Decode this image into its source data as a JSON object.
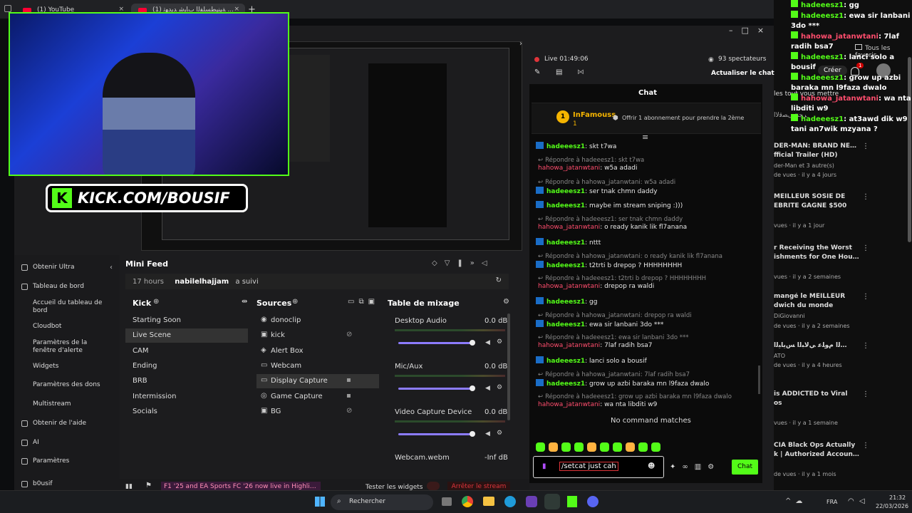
{
  "browser": {
    "tabs": [
      {
        "label": "(1) YouTube"
      },
      {
        "label": "(1) ﺔﻴﻨﻴﻄﺴﻠﻔﻟا بﺎﺒﺷ ﺪﻳﺪﻬﺗ ..."
      }
    ],
    "new_tab": "+"
  },
  "youtube": {
    "favorites_label": "Tous les favoris",
    "create_label": "Créer",
    "notif_count": "1",
    "items": [
      {
        "text": "les tout vous mettre",
        "sub": "ﺮﺠﻨﺗ ﻰﺼﻗﻷا"
      },
      {
        "text": "DER-MAN: BRAND NEW DAY",
        "title2": "fficial Trailer (HD)",
        "channel": "der-Man et 3 autre(s)",
        "meta": "de vues · il y a 4 jours"
      },
      {
        "text": "MEILLEUR SOSIE DE",
        "title2": "ÉBRITÉ GAGNE $500",
        "meta": "vues · il y a 1 jour"
      },
      {
        "text": "r Receiving the Worst",
        "title2": "ishments for One Hour ...",
        "meta": "vues · il y a 2 semaines"
      },
      {
        "text": "mangé le MEILLEUR",
        "title2": "dwich du monde",
        "channel": "DiGiovanni",
        "meta": "de vues · il y a 2 semaines"
      },
      {
        "text": "ﺔﻳﺮﻄﻟا مﻮﻠﻋ ﻲﻟﺎﺒﻟا ﺲﻳﺎﻴﻟا",
        "channel": "ATO",
        "meta": "de vues · il y a 4 heures"
      },
      {
        "text": "is ADDICTED to Viral",
        "title2": "os",
        "meta": "vues · il y a 1 semaine"
      },
      {
        "text": "CIA Black Ops Actually",
        "title2": "k | Authorized Account | ...",
        "meta": "de vues · il y a 1 mois"
      }
    ]
  },
  "overlay_chat": [
    {
      "user": "hadeeesz1",
      "text": "gg"
    },
    {
      "user": "hadeeesz1",
      "text": "ewa sir lanbani 3do ***"
    },
    {
      "user": "hahowa_jatanwtani",
      "text": "7laf radih bsa7"
    },
    {
      "user": "hadeeesz1",
      "text": "lanci solo a bousif"
    },
    {
      "user": "hadeeesz1",
      "text": "grow up azbi baraka mn l9faza dwalo"
    },
    {
      "user": "hahowa_jatanwtani",
      "text": "wa nta libditi w9"
    },
    {
      "user": "hadeeesz1",
      "text": "at3awd dik w9 tani an7wik mzyana ?"
    }
  ],
  "cam_overlay": {
    "url_text": "KICK.COM/BOUSIF"
  },
  "obs": {
    "live_label": "Live 01:49:06",
    "viewers": "93 spectateurs",
    "refresh_chat": "Actualiser le chat",
    "sidebar": [
      {
        "label": "Obtenir Ultra"
      },
      {
        "label": "Tableau de bord"
      },
      {
        "label": "Accueil du tableau de bord"
      },
      {
        "label": "Cloudbot"
      },
      {
        "label": "Paramètres de la fenêtre d'alerte"
      },
      {
        "label": "Widgets"
      },
      {
        "label": "Paramètres des dons"
      },
      {
        "label": "Multistream"
      },
      {
        "label": "Obtenir de l'aide"
      },
      {
        "label": "AI"
      },
      {
        "label": "Paramètres"
      },
      {
        "label": "b0usif"
      }
    ],
    "mini_feed": {
      "title": "Mini Feed",
      "time": "17 hours",
      "user": "nabilelhajjam",
      "action": "a suivi"
    },
    "scenes": {
      "title": "Kick",
      "items": [
        "Starting Soon",
        "Live Scene",
        "CAM",
        "Ending",
        "BRB",
        "Intermission",
        "Socials"
      ],
      "active": "Live Scene"
    },
    "sources": {
      "title": "Sources",
      "items": [
        "donoclip",
        "kick",
        "Alert Box",
        "Webcam",
        "Display Capture",
        "Game Capture",
        "BG"
      ],
      "active": "Display Capture"
    },
    "mixer": {
      "title": "Table de mixage",
      "channels": [
        {
          "name": "Desktop Audio",
          "db": "0.0 dB",
          "level": 0.8
        },
        {
          "name": "Mic/Aux",
          "db": "0.0 dB",
          "level": 0.8
        },
        {
          "name": "Video Capture Device",
          "db": "0.0 dB",
          "level": 0.8
        },
        {
          "name": "Webcam.webm",
          "db": "-Inf dB",
          "level": 0
        }
      ]
    },
    "footer": {
      "notice": "F1 '25 and EA Sports FC '26 now live in Highlighter!",
      "test_widgets": "Tester les widgets",
      "stop_stream": "Arrêter le stream"
    }
  },
  "chat": {
    "title": "Chat",
    "pinned": {
      "user": "InFamouss",
      "rank": "1",
      "count": "1",
      "gift": "Offrir 1 abonnement pour prendre la 2ème"
    },
    "messages": [
      {
        "reply": "",
        "user": "hadeeesz1",
        "text": "skt t7wa",
        "c": "g"
      },
      {
        "reply": "Répondre à hadeeesz1: skt t7wa",
        "user": "hahowa_jatanwtani",
        "text": "w5a adadi",
        "c": "r"
      },
      {
        "reply": "Répondre à hahowa_jatanwtani: w5a adadi",
        "user": "hadeeesz1",
        "text": "ser tnak chmn daddy",
        "c": "g"
      },
      {
        "reply": "",
        "user": "hadeeesz1",
        "text": "maybe im stream sniping :)))",
        "c": "g"
      },
      {
        "reply": "Répondre à hadeeesz1: ser tnak chmn daddy",
        "user": "hahowa_jatanwtani",
        "text": "o ready kanik lik fl7anana",
        "c": "r"
      },
      {
        "reply": "",
        "user": "hadeeesz1",
        "text": "nttt",
        "c": "g"
      },
      {
        "reply": "Répondre à hahowa_jatanwtani: o ready kanik lik fl7anana",
        "user": "hadeeesz1",
        "text": "t2trti b drepop ? HHHHHHHH",
        "c": "g"
      },
      {
        "reply": "Répondre à hadeeesz1: t2trti b drepop ? HHHHHHHH",
        "user": "hahowa_jatanwtani",
        "text": "drepop ra waldi",
        "c": "r"
      },
      {
        "reply": "",
        "user": "hadeeesz1",
        "text": "gg",
        "c": "g"
      },
      {
        "reply": "Répondre à hahowa_jatanwtani: drepop ra waldi",
        "user": "hadeeesz1",
        "text": "ewa sir lanbani 3do ***",
        "c": "g"
      },
      {
        "reply": "Répondre à hadeeesz1: ewa sir lanbani 3do ***",
        "user": "hahowa_jatanwtani",
        "text": "7laf radih bsa7",
        "c": "r"
      },
      {
        "reply": "",
        "user": "hadeeesz1",
        "text": "lanci solo a bousif",
        "c": "g"
      },
      {
        "reply": "Répondre à hahowa_jatanwtani: 7laf radih bsa7",
        "user": "hadeeesz1",
        "text": "grow up azbi baraka mn l9faza dwalo",
        "c": "g"
      },
      {
        "reply": "Répondre à hadeeesz1: grow up azbi baraka mn l9faza dwalo",
        "user": "hahowa_jatanwtani",
        "text": "wa nta libditi w9",
        "c": "r"
      }
    ],
    "no_matches": "No command matches",
    "input_value": "/setcat just cah",
    "send_label": "Chat"
  },
  "taskbar": {
    "search_label": "Rechercher",
    "lang": "FRA",
    "time": "21:32",
    "date": "22/03/2026"
  },
  "colors": {
    "kick_green": "#53fc18",
    "stop_red": "#e0343a",
    "mixer_purple": "#8c7cff"
  }
}
